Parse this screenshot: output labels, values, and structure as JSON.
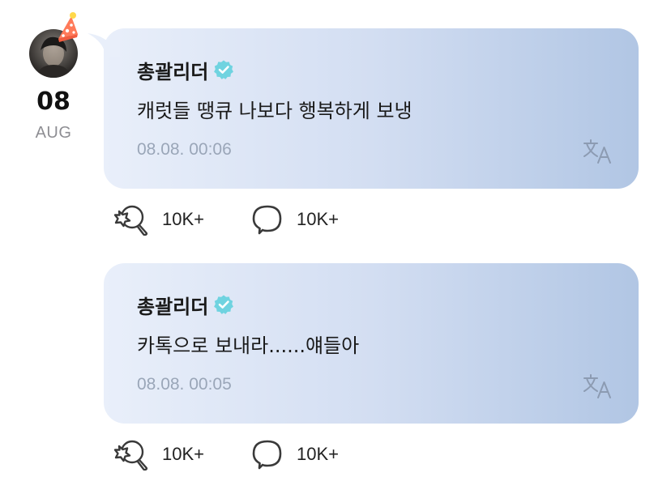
{
  "date": {
    "day": "08",
    "month": "AUG"
  },
  "posts": [
    {
      "author": "총괄리더",
      "message": "캐럿들 땡큐 나보다 행복하게 보냉",
      "timestamp": "08.08. 00:06",
      "likes": "10K+",
      "comments": "10K+"
    },
    {
      "author": "총괄리더",
      "message": "카톡으로 보내라......얘들아",
      "timestamp": "08.08. 00:05",
      "likes": "10K+",
      "comments": "10K+"
    }
  ],
  "colors": {
    "verified_badge": "#6fd3e0",
    "bubble_start": "#e9effa",
    "bubble_end": "#b1c6e4",
    "timestamp_text": "#9aa6b8",
    "party_hat": "#ff7a59"
  },
  "icons": {
    "verified": "verified-badge-icon",
    "translate": "translate-icon",
    "like": "lightstick-heart-icon",
    "comment": "speech-bubble-icon",
    "avatar_decoration": "party-hat-icon"
  }
}
